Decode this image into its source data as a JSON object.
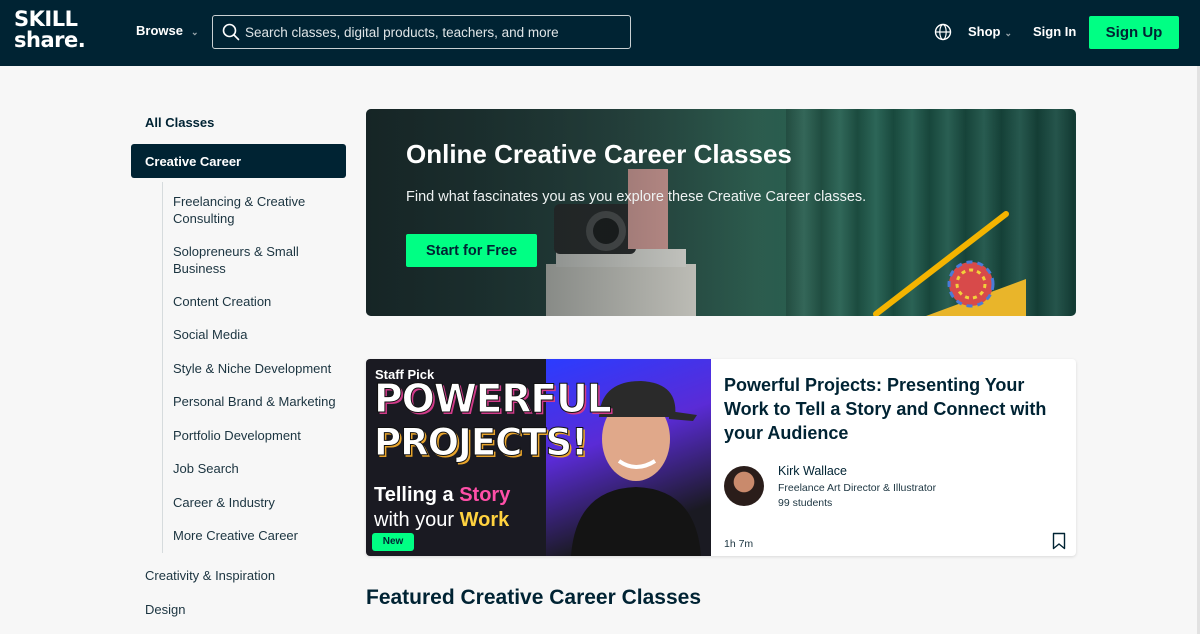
{
  "header": {
    "logo_line1": "SKILL",
    "logo_line2": "share.",
    "browse_label": "Browse",
    "search_placeholder": "Search classes, digital products, teachers, and more",
    "shop_label": "Shop",
    "sign_in_label": "Sign In",
    "sign_up_label": "Sign Up",
    "accent_color": "#00ff84",
    "bar_color": "#002333"
  },
  "sidebar": {
    "all_classes": "All Classes",
    "active": "Creative Career",
    "sub_items": [
      "Freelancing & Creative Consulting",
      "Solopreneurs & Small Business",
      "Content Creation",
      "Social Media",
      "Style & Niche Development",
      "Personal Brand & Marketing",
      "Portfolio Development",
      "Job Search",
      "Career & Industry",
      "More Creative Career"
    ],
    "other_categories": [
      "Creativity & Inspiration",
      "Design"
    ]
  },
  "hero": {
    "title": "Online Creative Career Classes",
    "subtitle": "Find what fascinates you as you explore these Creative Career classes.",
    "cta": "Start for Free"
  },
  "featured_class": {
    "thumbnail": {
      "staff_pick": "Staff Pick",
      "headline_line1": "POWERFUL",
      "headline_line2": "PROJECTS!",
      "tagline_part1": "Telling a ",
      "tagline_highlight1": "Story",
      "tagline_part2": "with your ",
      "tagline_highlight2": "Work",
      "badge": "New"
    },
    "title": "Powerful Projects: Presenting Your Work to Tell a Story and Connect with your Audience",
    "teacher_name": "Kirk Wallace",
    "teacher_role": "Freelance Art Director & Illustrator",
    "students": "99 students",
    "duration": "1h 7m"
  },
  "section_heading": "Featured Creative Career Classes"
}
